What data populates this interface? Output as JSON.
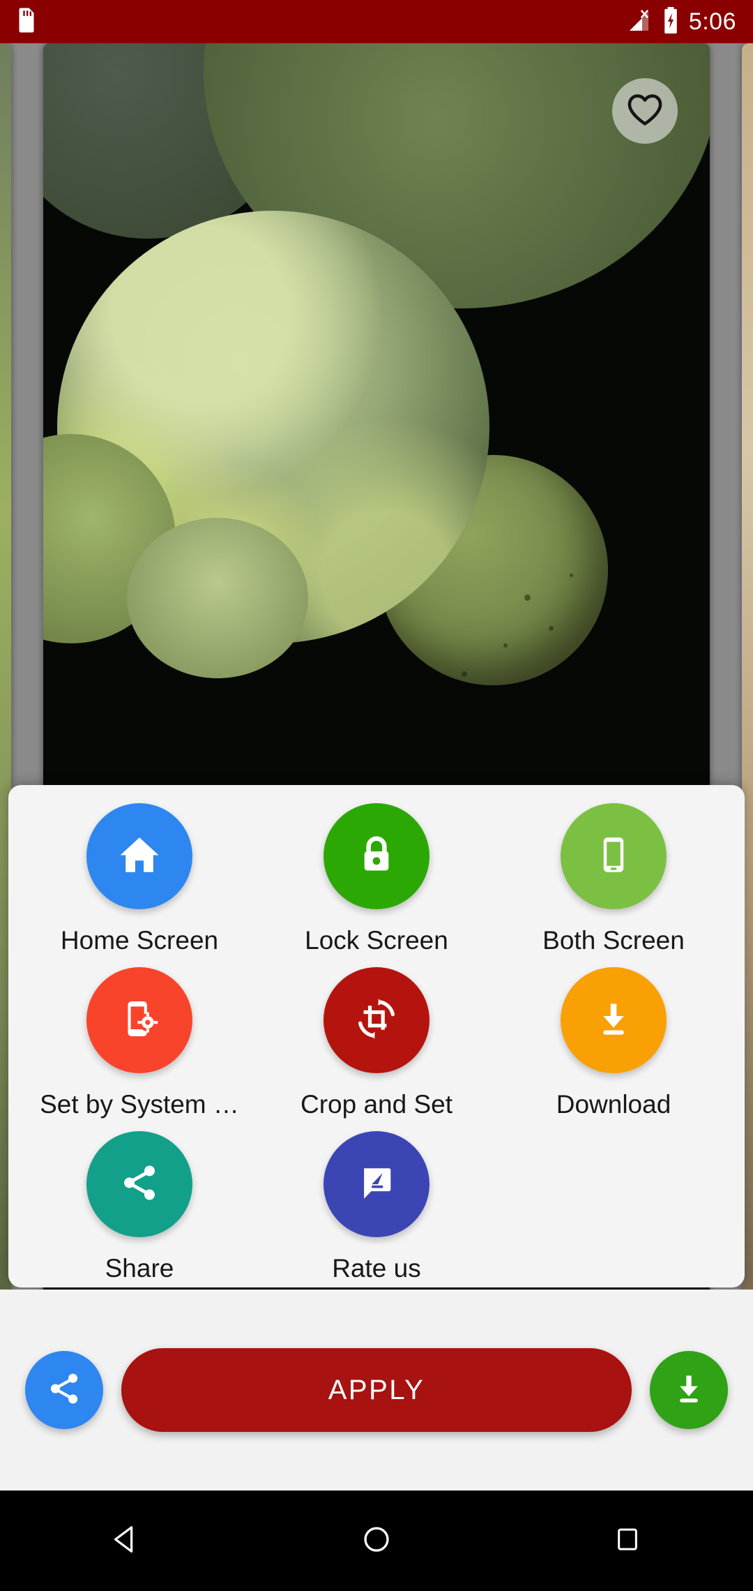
{
  "status_bar": {
    "background_color": "#8A0000",
    "time": "5:06",
    "icons": {
      "storage": "sd-card-icon",
      "signal": "no-signal-icon",
      "battery": "battery-charging-icon"
    }
  },
  "preview": {
    "favorite_icon": "heart-outline-icon",
    "favorite_active": false,
    "wallpaper_description": "green sea glass pebbles on black"
  },
  "options_sheet": {
    "background_color": "#F4F4F4",
    "items": [
      {
        "label": "Home Screen",
        "icon": "home-icon",
        "color": "#2E86F0"
      },
      {
        "label": "Lock Screen",
        "icon": "lock-icon",
        "color": "#2CA805"
      },
      {
        "label": "Both Screen",
        "icon": "smartphone-icon",
        "color": "#7CC043"
      },
      {
        "label": "Set by System …",
        "icon": "phone-settings-icon",
        "color": "#F9442C"
      },
      {
        "label": "Crop and Set",
        "icon": "crop-rotate-icon",
        "color": "#B5140E"
      },
      {
        "label": "Download",
        "icon": "download-icon",
        "color": "#F9A005"
      },
      {
        "label": "Share",
        "icon": "share-icon",
        "color": "#12A08A"
      },
      {
        "label": "Rate us",
        "icon": "rate-review-icon",
        "color": "#3B45B4"
      }
    ]
  },
  "action_bar": {
    "background_color": "#F2F2F2",
    "share_icon": "share-icon",
    "share_color": "#2E86F0",
    "apply_label": "APPLY",
    "apply_color": "#A81210",
    "download_icon": "download-icon",
    "download_color": "#2FA215"
  },
  "nav_bar": {
    "background_color": "#000000",
    "buttons": [
      {
        "name": "back",
        "icon": "triangle-back-icon"
      },
      {
        "name": "home",
        "icon": "circle-home-icon"
      },
      {
        "name": "recents",
        "icon": "square-recents-icon"
      }
    ]
  }
}
